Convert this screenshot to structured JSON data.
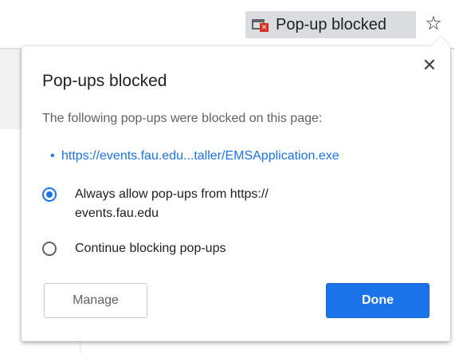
{
  "toolbar": {
    "popup_chip_label": "Pop-up blocked",
    "popup_chip_icon": "popup-blocked-icon",
    "bookmark_icon": "star-icon",
    "bookmark_glyph": "☆"
  },
  "bubble": {
    "title": "Pop-ups blocked",
    "description": "The following pop-ups were blocked on this page:",
    "blocked_items": [
      {
        "bullet": "•",
        "url": "https://events.fau.edu...taller/EMSApplication.exe"
      }
    ],
    "options": [
      {
        "label": "Always allow pop-ups from https://\nevents.fau.edu",
        "selected": true
      },
      {
        "label": "Continue blocking pop-ups",
        "selected": false
      }
    ],
    "close_glyph": "✕",
    "manage_label": "Manage",
    "done_label": "Done"
  },
  "colors": {
    "accent": "#1a73e8",
    "chip_bg": "#dadce0",
    "text_secondary": "#5f6368"
  }
}
